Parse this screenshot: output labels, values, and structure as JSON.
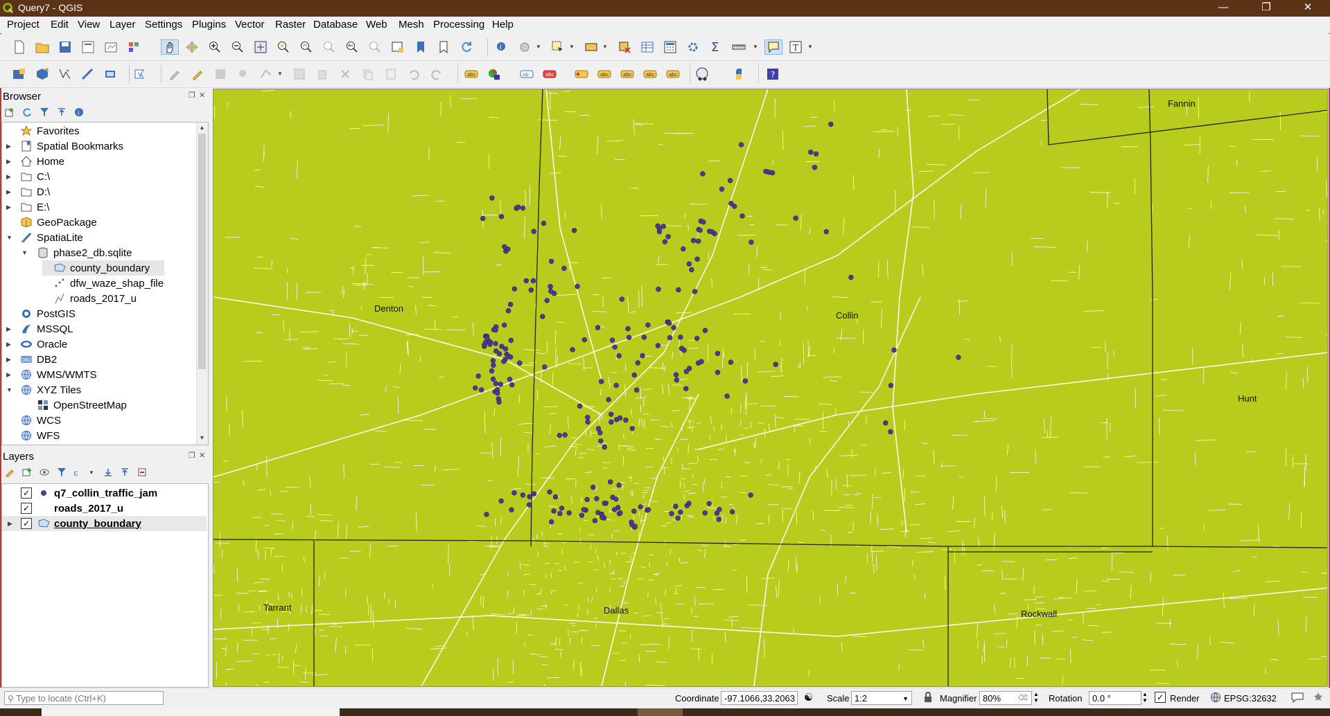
{
  "window": {
    "title": "Query7 - QGIS"
  },
  "menu": [
    "Project",
    "Edit",
    "View",
    "Layer",
    "Settings",
    "Plugins",
    "Vector",
    "Raster",
    "Database",
    "Web",
    "Mesh",
    "Processing",
    "Help"
  ],
  "browser": {
    "title": "Browser",
    "items": [
      {
        "label": "Favorites",
        "icon": "star-icon"
      },
      {
        "label": "Spatial Bookmarks",
        "icon": "bookmark-icon"
      },
      {
        "label": "Home",
        "icon": "home-icon"
      },
      {
        "label": "C:\\",
        "icon": "folder-icon"
      },
      {
        "label": "D:\\",
        "icon": "folder-icon"
      },
      {
        "label": "E:\\",
        "icon": "folder-icon"
      },
      {
        "label": "GeoPackage",
        "icon": "geopackage-icon"
      },
      {
        "label": "SpatiaLite",
        "icon": "spatialite-icon"
      },
      {
        "label": "phase2_db.sqlite",
        "icon": "database-icon"
      },
      {
        "label": "county_boundary",
        "icon": "polygon-layer-icon"
      },
      {
        "label": "dfw_waze_shap_file",
        "icon": "point-layer-icon"
      },
      {
        "label": "roads_2017_u",
        "icon": "line-layer-icon"
      },
      {
        "label": "PostGIS",
        "icon": "postgis-icon"
      },
      {
        "label": "MSSQL",
        "icon": "mssql-icon"
      },
      {
        "label": "Oracle",
        "icon": "oracle-icon"
      },
      {
        "label": "DB2",
        "icon": "db2-icon"
      },
      {
        "label": "WMS/WMTS",
        "icon": "globe-icon"
      },
      {
        "label": "XYZ Tiles",
        "icon": "globe-icon"
      },
      {
        "label": "OpenStreetMap",
        "icon": "tiles-icon"
      },
      {
        "label": "WCS",
        "icon": "globe-icon"
      },
      {
        "label": "WFS",
        "icon": "globe-icon"
      }
    ]
  },
  "layers": {
    "title": "Layers",
    "items": [
      {
        "label": "q7_collin_traffic_jam",
        "checked": true,
        "symbol": "point",
        "color": "#4b3a8f"
      },
      {
        "label": "roads_2017_u",
        "checked": true,
        "symbol": "line",
        "color": "#ffffff"
      },
      {
        "label": "county_boundary",
        "checked": true,
        "symbol": "polygon",
        "color": "#b7cc1d"
      }
    ]
  },
  "map": {
    "fill_color": "#b7cc1d",
    "road_color": "#fff9e6",
    "point_color": "#4b3a8f",
    "labels": [
      "Fannin",
      "Denton",
      "Collin",
      "Hunt",
      "Tarrant",
      "Dallas",
      "Rockwall"
    ]
  },
  "status": {
    "locate_placeholder": "Type to locate (Ctrl+K)",
    "coordinate_label": "Coordinate",
    "coordinate_value": "-97.1066,33.2063",
    "scale_label": "Scale",
    "scale_value": "1:2",
    "magnifier_label": "Magnifier",
    "magnifier_value": "80%",
    "rotation_label": "Rotation",
    "rotation_value": "0.0 °",
    "render_label": "Render",
    "crs_value": "EPSG:32632"
  }
}
